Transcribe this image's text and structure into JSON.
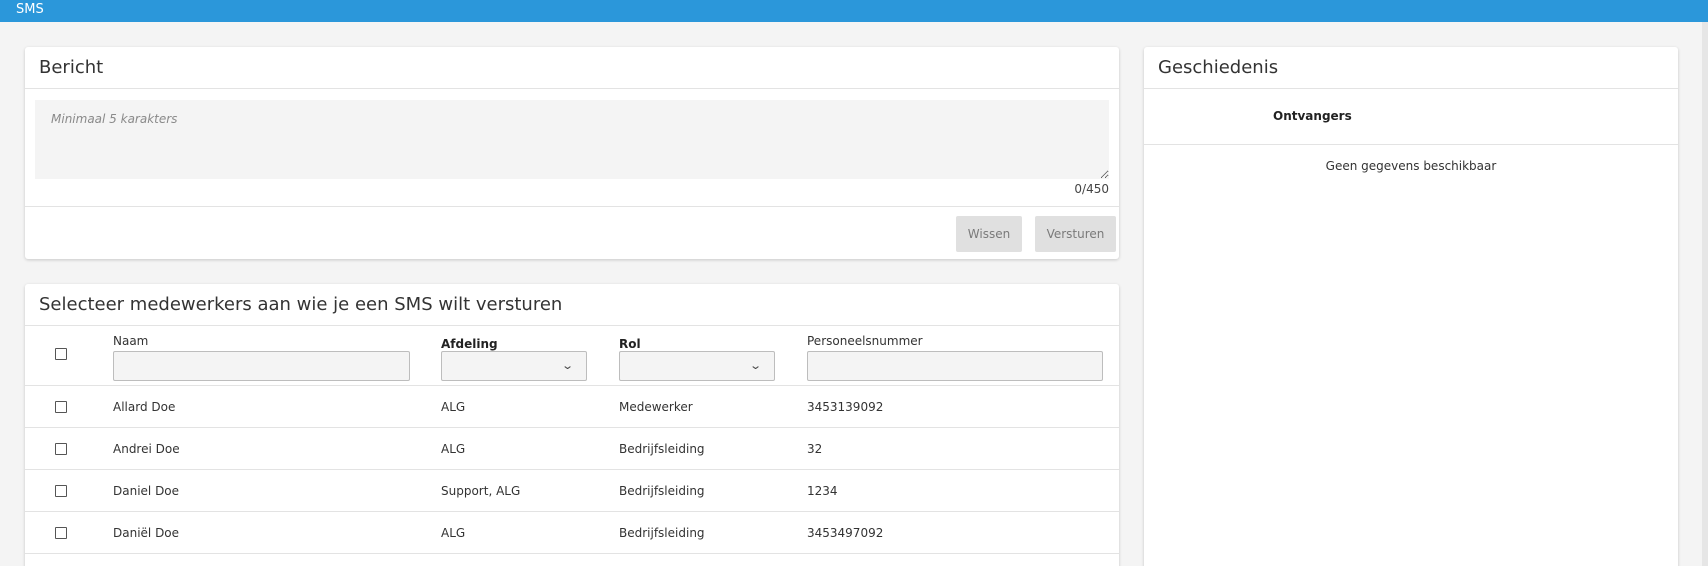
{
  "app": {
    "title": "SMS"
  },
  "message_card": {
    "title": "Bericht",
    "placeholder": "Minimaal 5 karakters",
    "counter": "0/450",
    "clear_label": "Wissen",
    "send_label": "Versturen"
  },
  "select_card": {
    "title": "Selecteer medewerkers aan wie je een SMS wilt versturen",
    "columns": {
      "name": "Naam",
      "department": "Afdeling",
      "role": "Rol",
      "employee_number": "Personeelsnummer"
    },
    "rows": [
      {
        "name": "Allard Doe",
        "department": "ALG",
        "role": "Medewerker",
        "employee_number": "3453139092"
      },
      {
        "name": "Andrei Doe",
        "department": "ALG",
        "role": "Bedrijfsleiding",
        "employee_number": "32"
      },
      {
        "name": "Daniel Doe",
        "department": "Support, ALG",
        "role": "Bedrijfsleiding",
        "employee_number": "1234"
      },
      {
        "name": "Daniël Doe",
        "department": "ALG",
        "role": "Bedrijfsleiding",
        "employee_number": "3453497092"
      }
    ]
  },
  "history_card": {
    "title": "Geschiedenis",
    "column_recipients": "Ontvangers",
    "empty_text": "Geen gegevens beschikbaar"
  },
  "colors": {
    "header_bar": "#2b97da",
    "background": "#f4f4f4"
  },
  "icons": {
    "dropdown": "chevron-down-icon"
  }
}
